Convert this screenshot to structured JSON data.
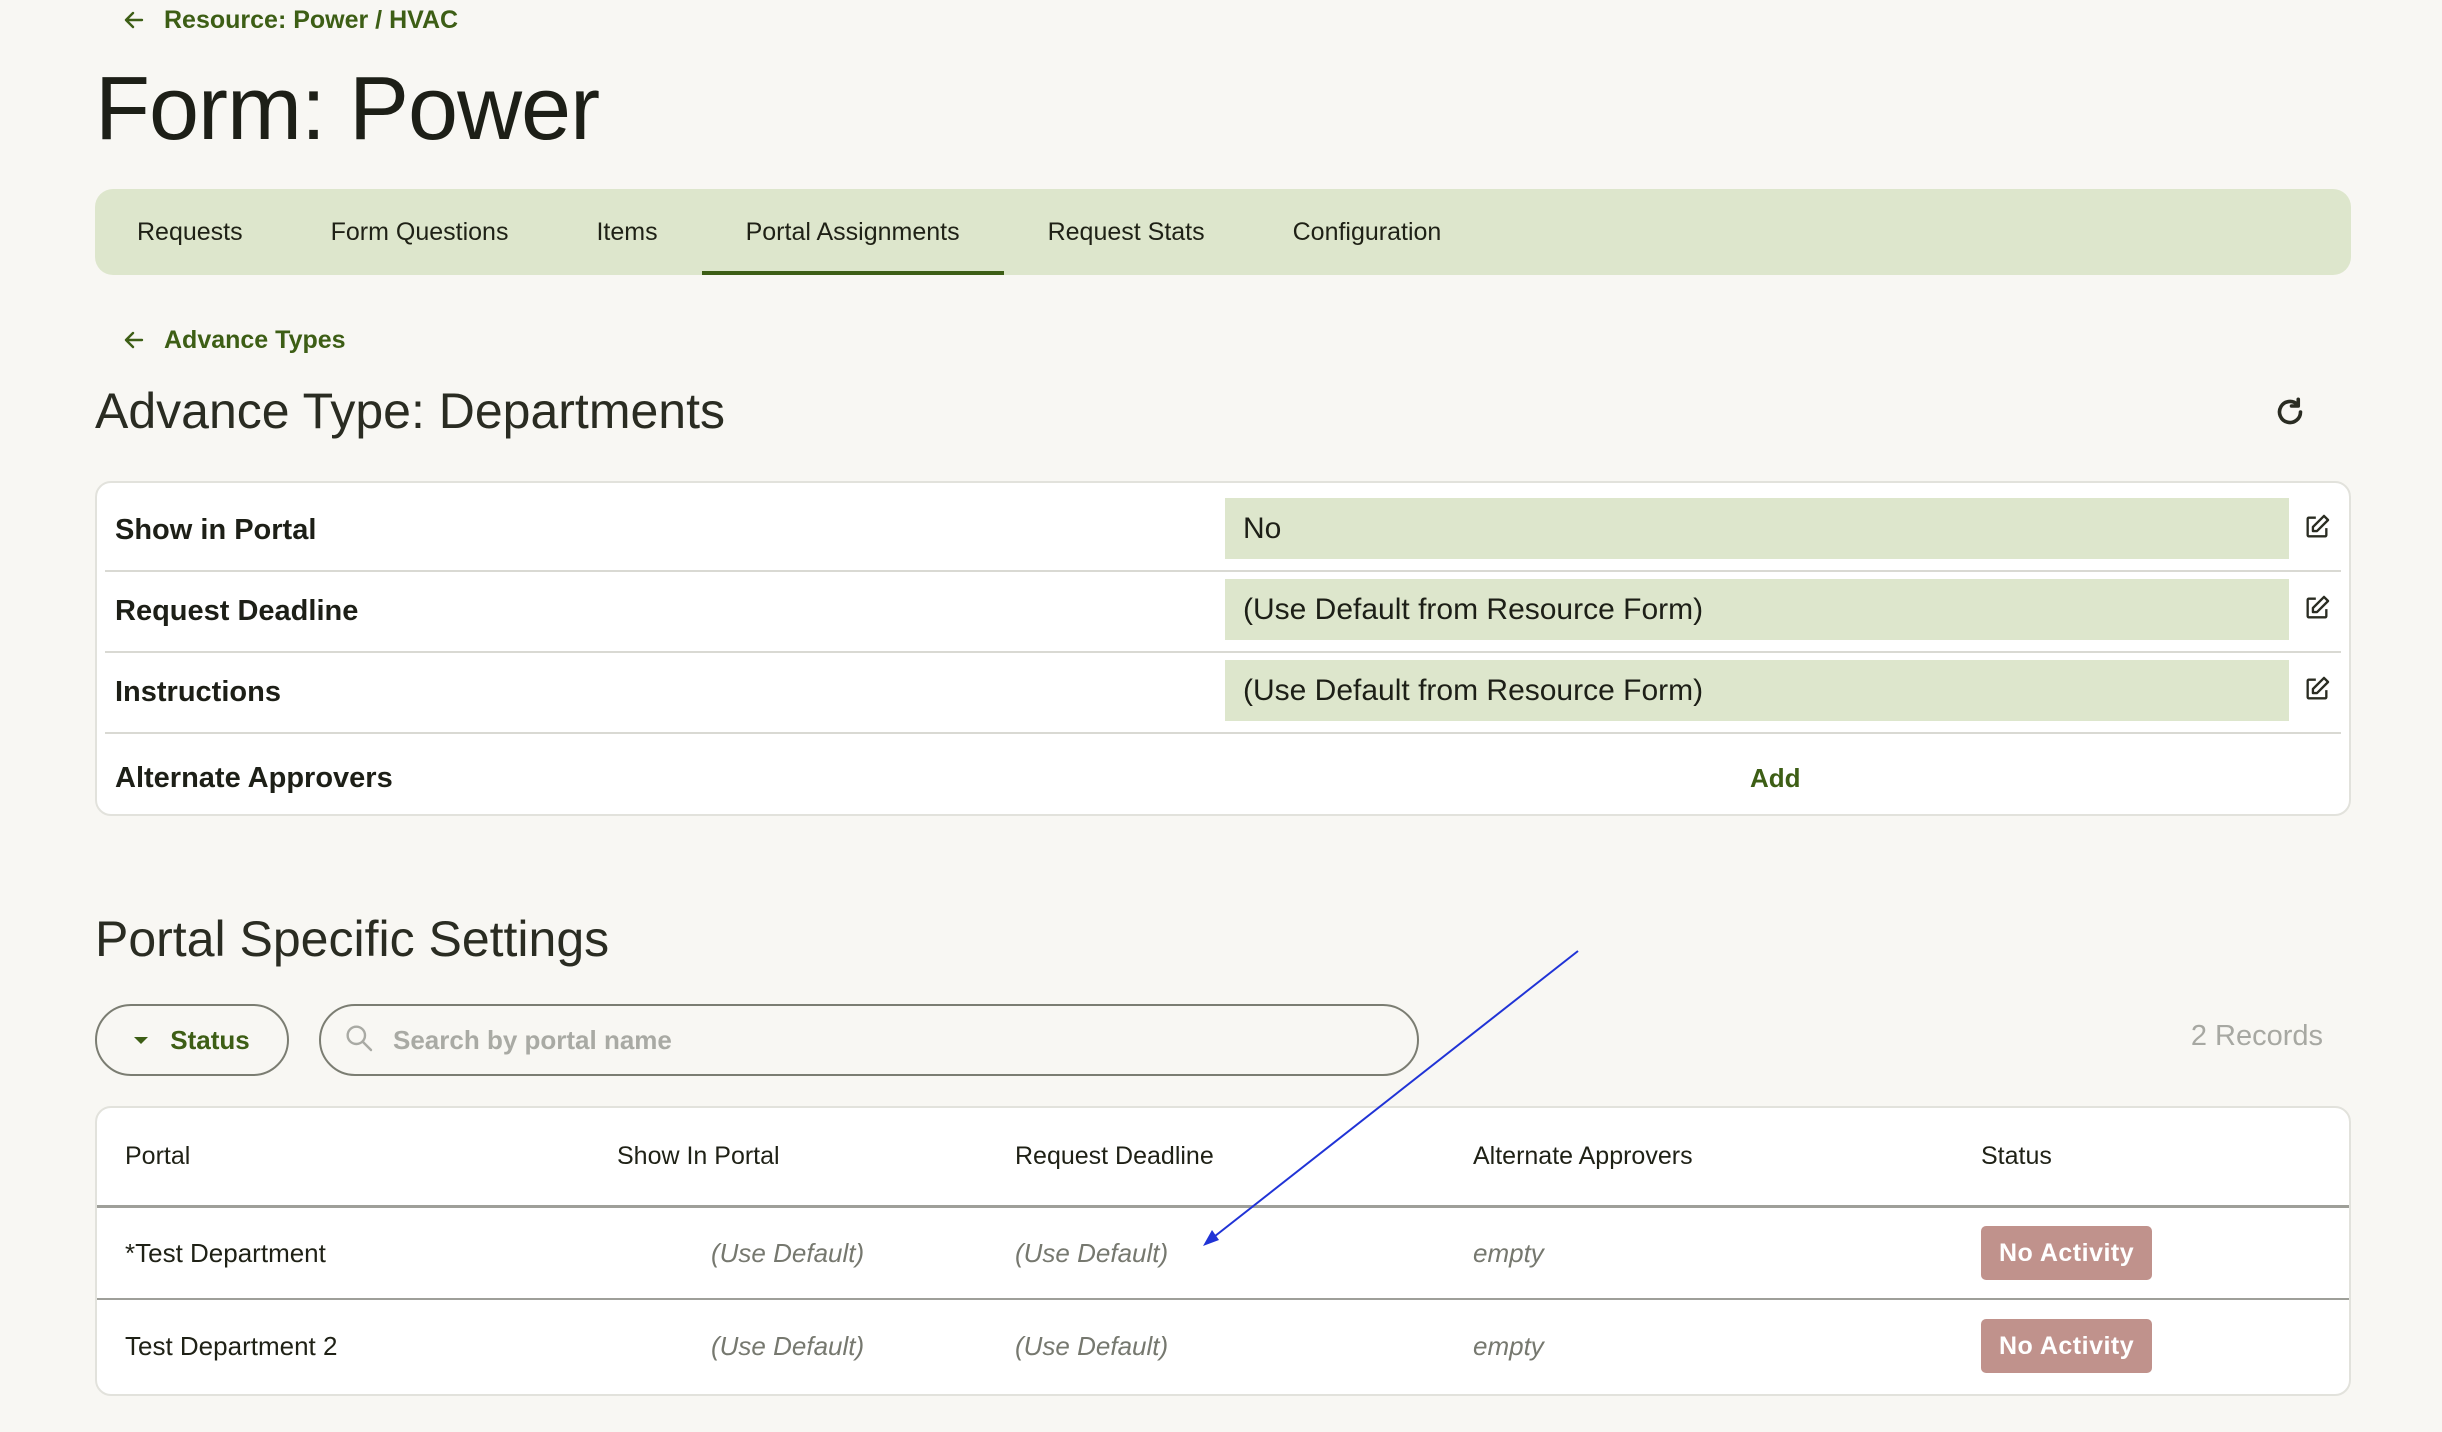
{
  "breadcrumb": {
    "label": "Resource: Power / HVAC"
  },
  "page_title": "Form: Power",
  "tabs": [
    {
      "label": "Requests"
    },
    {
      "label": "Form Questions"
    },
    {
      "label": "Items"
    },
    {
      "label": "Portal Assignments",
      "active": true
    },
    {
      "label": "Request Stats"
    },
    {
      "label": "Configuration"
    }
  ],
  "sub_breadcrumb": {
    "label": "Advance Types"
  },
  "advance_type_title": "Advance Type: Departments",
  "properties": [
    {
      "label": "Show in Portal",
      "value": "No"
    },
    {
      "label": "Request Deadline",
      "value": "(Use Default from Resource Form)"
    },
    {
      "label": "Instructions",
      "value": "(Use Default from Resource Form)"
    },
    {
      "label": "Alternate Approvers",
      "action": "Add"
    }
  ],
  "portal_section": {
    "title": "Portal Specific Settings",
    "status_filter_label": "Status",
    "search_placeholder": "Search by portal name",
    "records_count": "2 Records",
    "columns": [
      "Portal",
      "Show In Portal",
      "Request Deadline",
      "Alternate Approvers",
      "Status"
    ],
    "rows": [
      {
        "portal": "*Test Department",
        "show_in_portal": "(Use Default)",
        "request_deadline": "(Use Default)",
        "alternate_approvers": "empty",
        "status": "No Activity"
      },
      {
        "portal": "Test Department 2",
        "show_in_portal": "(Use Default)",
        "request_deadline": "(Use Default)",
        "alternate_approvers": "empty",
        "status": "No Activity"
      }
    ]
  },
  "colors": {
    "accent": "#3d5e15",
    "tab_bar": "#dde6cc",
    "badge": "#c0928c",
    "annotation_arrow": "#2033d6"
  }
}
